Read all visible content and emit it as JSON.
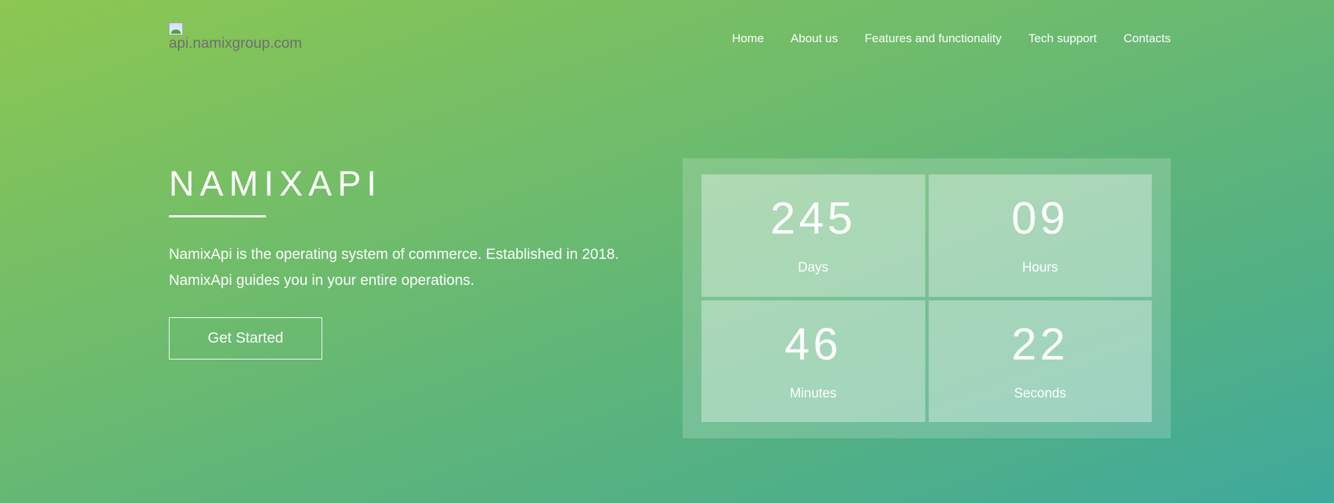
{
  "logo": {
    "alt": "api.namixgroup.com"
  },
  "nav": [
    "Home",
    "About us",
    "Features and functionality",
    "Tech support",
    "Contacts"
  ],
  "hero": {
    "title": "NAMIXAPI",
    "lines": [
      "NamixApi is the operating system of commerce. Established in 2018.",
      "NamixApi guides you in your entire operations."
    ],
    "button": "Get Started"
  },
  "countdown": [
    {
      "value": "245",
      "label": "Days"
    },
    {
      "value": "09",
      "label": "Hours"
    },
    {
      "value": "46",
      "label": "Minutes"
    },
    {
      "value": "22",
      "label": "Seconds"
    }
  ]
}
